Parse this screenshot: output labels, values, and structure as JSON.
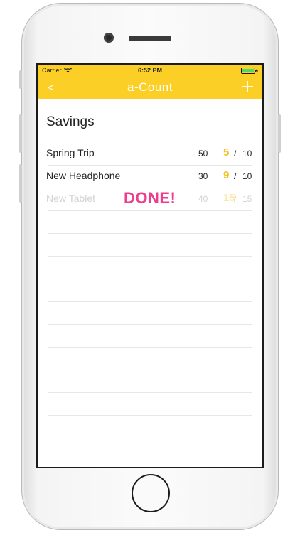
{
  "status_bar": {
    "carrier": "Carrier",
    "time": "6:52 PM",
    "wifi_icon": "wifi-icon",
    "battery_icon": "battery-charging-icon",
    "battery_color": "#4cd964"
  },
  "nav": {
    "back_label": "<",
    "title": "a-Count",
    "add_icon": "plus-icon",
    "bar_color": "#fbcf26"
  },
  "section": {
    "title": "Savings"
  },
  "items": [
    {
      "name": "Spring Trip",
      "target": "50",
      "count": "5",
      "total": "10",
      "done": false
    },
    {
      "name": "New Headphone",
      "target": "30",
      "count": "9",
      "total": "10",
      "done": false
    },
    {
      "name": "New Tablet",
      "target": "40",
      "count": "15",
      "total": "15",
      "done": true,
      "badge": "DONE!"
    }
  ],
  "separator": "/",
  "colors": {
    "count": "#f3c21a",
    "done_badge": "#ec3d8e"
  }
}
